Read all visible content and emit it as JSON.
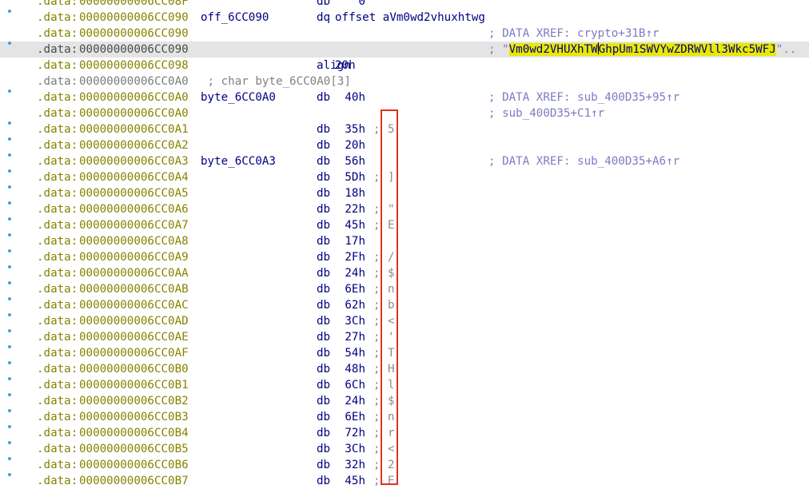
{
  "listing": {
    "rows": [
      {
        "seg": ".data:",
        "addr": "00000000006CC08F",
        "mn": "db",
        "op": "0",
        "dot": false
      },
      {
        "seg": ".data:",
        "addr": "00000000006CC090",
        "label": "off_6CC090",
        "mn": "dq",
        "op": "offset aVm0wd2vhuxhtwg",
        "dot": true
      },
      {
        "seg": ".data:",
        "addr": "00000000006CC090",
        "cm": "; DATA XREF: crypto+31B↑r",
        "dot": false
      },
      {
        "seg": ".data:",
        "addr": "00000000006CC090",
        "cm_prefix": "; \"",
        "cm_str_a": "Vm0wd2VHUXhTW",
        "cm_str_b": "GhpUm1SWVYwZDRWVll3Wkc5WFJ",
        "cm_suffix": "\"..",
        "dot": true
      },
      {
        "seg": ".data:",
        "addr": "00000000006CC098",
        "mn": "align",
        "op": "20h",
        "dot": false
      },
      {
        "seg": ".data:",
        "addr": "00000000006CC0A0",
        "comment": " ; char byte_6CC0A0[3]",
        "dot": false
      },
      {
        "seg": ".data:",
        "addr": "00000000006CC0A0",
        "label": "byte_6CC0A0",
        "mn": "db",
        "op": "40h",
        "cm": "; DATA XREF: sub_400D35+95↑r",
        "dot": true
      },
      {
        "seg": ".data:",
        "addr": "00000000006CC0A0",
        "cm": "; sub_400D35+C1↑r",
        "dot": false
      },
      {
        "seg": ".data:",
        "addr": "00000000006CC0A1",
        "mn": "db",
        "op": "35h",
        "semi": ";",
        "ch": "5",
        "dot": true
      },
      {
        "seg": ".data:",
        "addr": "00000000006CC0A2",
        "mn": "db",
        "op": "20h",
        "dot": true
      },
      {
        "seg": ".data:",
        "addr": "00000000006CC0A3",
        "label": "byte_6CC0A3",
        "mn": "db",
        "op": "56h",
        "cm": "; DATA XREF: sub_400D35+A6↑r",
        "dot": true
      },
      {
        "seg": ".data:",
        "addr": "00000000006CC0A4",
        "mn": "db",
        "op": "5Dh",
        "semi": ";",
        "ch": "]",
        "dot": true
      },
      {
        "seg": ".data:",
        "addr": "00000000006CC0A5",
        "mn": "db",
        "op": "18h",
        "dot": true
      },
      {
        "seg": ".data:",
        "addr": "00000000006CC0A6",
        "mn": "db",
        "op": "22h",
        "semi": ";",
        "ch": "\"",
        "dot": true
      },
      {
        "seg": ".data:",
        "addr": "00000000006CC0A7",
        "mn": "db",
        "op": "45h",
        "semi": ";",
        "ch": "E",
        "dot": true
      },
      {
        "seg": ".data:",
        "addr": "00000000006CC0A8",
        "mn": "db",
        "op": "17h",
        "dot": true
      },
      {
        "seg": ".data:",
        "addr": "00000000006CC0A9",
        "mn": "db",
        "op": "2Fh",
        "semi": ";",
        "ch": "/",
        "dot": true
      },
      {
        "seg": ".data:",
        "addr": "00000000006CC0AA",
        "mn": "db",
        "op": "24h",
        "semi": ";",
        "ch": "$",
        "dot": true
      },
      {
        "seg": ".data:",
        "addr": "00000000006CC0AB",
        "mn": "db",
        "op": "6Eh",
        "semi": ";",
        "ch": "n",
        "dot": true
      },
      {
        "seg": ".data:",
        "addr": "00000000006CC0AC",
        "mn": "db",
        "op": "62h",
        "semi": ";",
        "ch": "b",
        "dot": true
      },
      {
        "seg": ".data:",
        "addr": "00000000006CC0AD",
        "mn": "db",
        "op": "3Ch",
        "semi": ";",
        "ch": "<",
        "dot": true
      },
      {
        "seg": ".data:",
        "addr": "00000000006CC0AE",
        "mn": "db",
        "op": "27h",
        "semi": ";",
        "ch": "'",
        "dot": true
      },
      {
        "seg": ".data:",
        "addr": "00000000006CC0AF",
        "mn": "db",
        "op": "54h",
        "semi": ";",
        "ch": "T",
        "dot": true
      },
      {
        "seg": ".data:",
        "addr": "00000000006CC0B0",
        "mn": "db",
        "op": "48h",
        "semi": ";",
        "ch": "H",
        "dot": true
      },
      {
        "seg": ".data:",
        "addr": "00000000006CC0B1",
        "mn": "db",
        "op": "6Ch",
        "semi": ";",
        "ch": "l",
        "dot": true
      },
      {
        "seg": ".data:",
        "addr": "00000000006CC0B2",
        "mn": "db",
        "op": "24h",
        "semi": ";",
        "ch": "$",
        "dot": true
      },
      {
        "seg": ".data:",
        "addr": "00000000006CC0B3",
        "mn": "db",
        "op": "6Eh",
        "semi": ";",
        "ch": "n",
        "dot": true
      },
      {
        "seg": ".data:",
        "addr": "00000000006CC0B4",
        "mn": "db",
        "op": "72h",
        "semi": ";",
        "ch": "r",
        "dot": true
      },
      {
        "seg": ".data:",
        "addr": "00000000006CC0B5",
        "mn": "db",
        "op": "3Ch",
        "semi": ";",
        "ch": "<",
        "dot": true
      },
      {
        "seg": ".data:",
        "addr": "00000000006CC0B6",
        "mn": "db",
        "op": "32h",
        "semi": ";",
        "ch": "2",
        "dot": true
      },
      {
        "seg": ".data:",
        "addr": "00000000006CC0B7",
        "mn": "db",
        "op": "45h",
        "semi": ";",
        "ch": "E",
        "dot": true
      }
    ]
  },
  "colors": {
    "segment_address": "#848400",
    "name_address": "#7a7a7a",
    "label_and_instruction": "#000080",
    "xref_comment": "#7b7bc4",
    "char_comment": "#8c8c8c",
    "string_highlight": "#e8e800",
    "current_line": "#e4e4e4",
    "annotation_box": "#e3301f",
    "gutter_dot": "#3aa3e3"
  }
}
